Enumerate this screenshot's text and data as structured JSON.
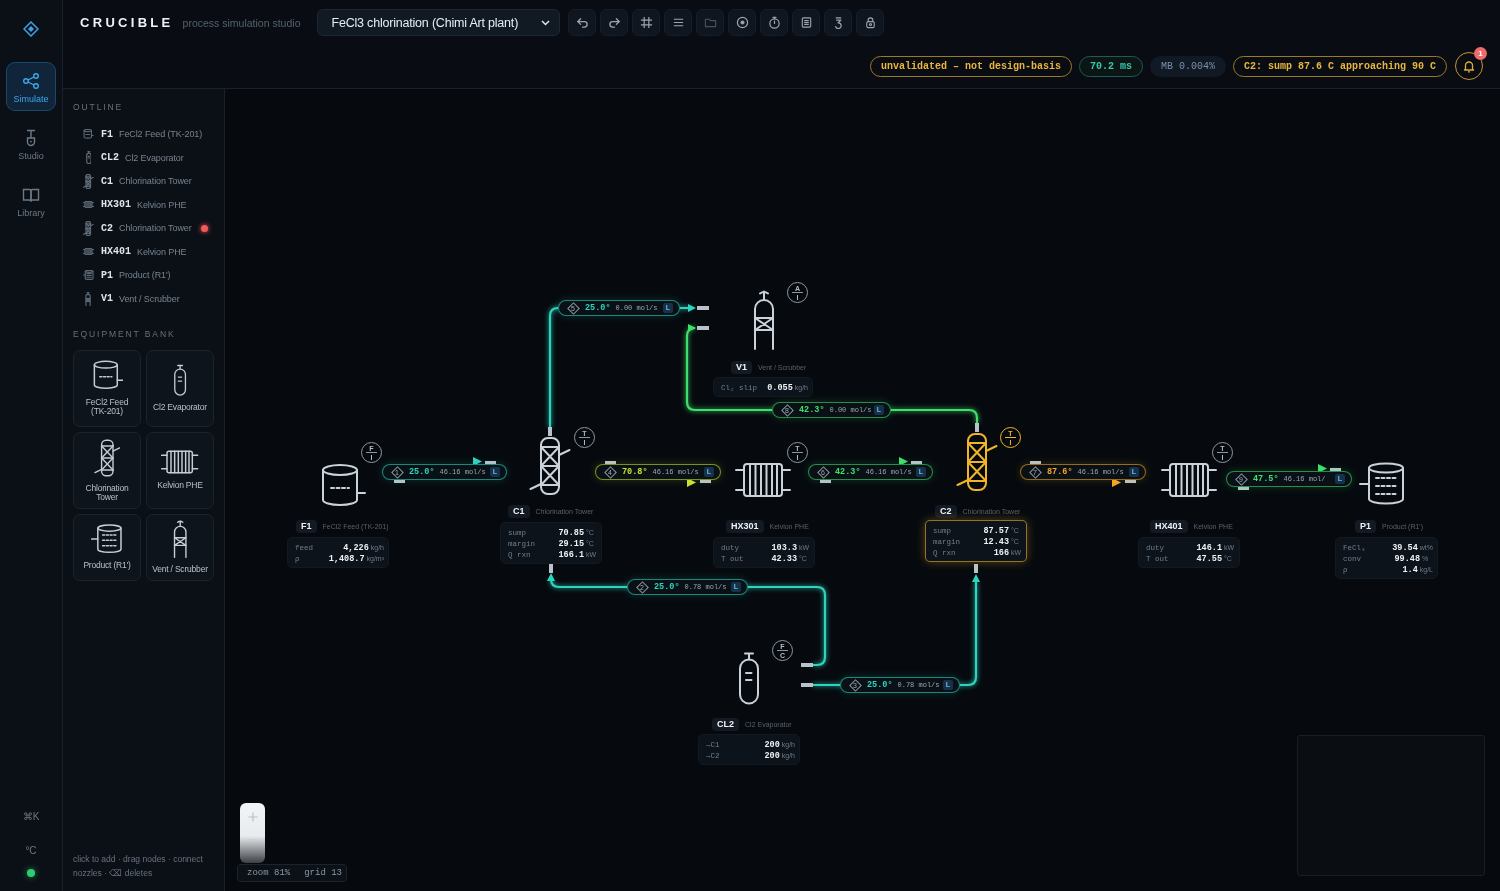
{
  "brand": {
    "name": "CRUCIBLE",
    "tagline": "process simulation studio"
  },
  "nav": [
    {
      "label": "Simulate",
      "kind": "share",
      "selected": true
    },
    {
      "label": "Studio",
      "kind": "shovel",
      "selected": false
    },
    {
      "label": "Library",
      "kind": "book",
      "selected": false
    }
  ],
  "rail_footer": {
    "shortcut": "⌘K",
    "unit": "°C",
    "connected": true
  },
  "project_select": {
    "value": "FeCl3 chlorination (Chimi Art plant)"
  },
  "toolbar": [
    {
      "kind": "undo",
      "disabled": false
    },
    {
      "kind": "redo",
      "disabled": false
    },
    {
      "kind": "frame",
      "disabled": false
    },
    {
      "kind": "list",
      "disabled": false
    },
    {
      "kind": "folder",
      "disabled": true
    },
    {
      "kind": "target",
      "disabled": false
    },
    {
      "kind": "stopwatch",
      "disabled": false
    },
    {
      "kind": "sheet",
      "disabled": false
    },
    {
      "kind": "glyph",
      "disabled": false
    },
    {
      "kind": "padlock",
      "disabled": false
    }
  ],
  "status_badges": [
    {
      "text": "unvalidated – not design-basis",
      "kind": "warning"
    },
    {
      "text": "70.2 ms",
      "kind": "timing"
    },
    {
      "text": "MB 0.004%",
      "kind": "neutral"
    },
    {
      "text": "C2: sump 87.6 C approaching 90 C",
      "kind": "warning"
    }
  ],
  "notifications": {
    "count": "1"
  },
  "outline": {
    "title": "OUTLINE",
    "items": [
      {
        "tag": "F1",
        "name": "FeCl2 Feed (TK-201)",
        "kind": "tank",
        "alarm": false
      },
      {
        "tag": "CL2",
        "name": "Cl2 Evaporator",
        "kind": "evaporator",
        "alarm": false
      },
      {
        "tag": "C1",
        "name": "Chlorination Tower",
        "kind": "column",
        "alarm": false
      },
      {
        "tag": "HX301",
        "name": "Kelvion PHE",
        "kind": "phe",
        "alarm": false
      },
      {
        "tag": "C2",
        "name": "Chlorination Tower",
        "kind": "column",
        "alarm": true
      },
      {
        "tag": "HX401",
        "name": "Kelvion PHE",
        "kind": "phe",
        "alarm": false
      },
      {
        "tag": "P1",
        "name": "Product (R1')",
        "kind": "product",
        "alarm": false
      },
      {
        "tag": "V1",
        "name": "Vent / Scrubber",
        "kind": "vent",
        "alarm": false
      }
    ]
  },
  "equipment_bank": {
    "title": "EQUIPMENT BANK",
    "items": [
      {
        "label": "FeCl2 Feed (TK-201)",
        "kind": "tank"
      },
      {
        "label": "Cl2 Evaporator",
        "kind": "evaporator"
      },
      {
        "label": "Chlorination Tower",
        "kind": "column"
      },
      {
        "label": "Kelvion PHE",
        "kind": "phe"
      },
      {
        "label": "Product (R1')",
        "kind": "product"
      },
      {
        "label": "Vent / Scrubber",
        "kind": "vent"
      }
    ]
  },
  "hint": "click to add · drag nodes · connect nozzles · ⌫ deletes",
  "canvas": {
    "nodes": [
      {
        "tag": "F1",
        "name": "FeCl2 Feed (TK-201)",
        "kind": "tank",
        "alarm": false,
        "instrument": {
          "variable": "F",
          "function": "I"
        },
        "readings": [
          {
            "label": "feed",
            "value": "4,226",
            "unit": "kg/h"
          },
          {
            "label": "ρ",
            "value": "1,408.7",
            "unit": "kg/m³"
          }
        ]
      },
      {
        "tag": "CL2",
        "name": "Cl2 Evaporator",
        "kind": "evaporator",
        "alarm": false,
        "instrument": {
          "variable": "F",
          "function": "C"
        },
        "readings": [
          {
            "label": "→C1",
            "value": "200",
            "unit": "kg/h"
          },
          {
            "label": "→C2",
            "value": "200",
            "unit": "kg/h"
          }
        ]
      },
      {
        "tag": "C1",
        "name": "Chlorination Tower",
        "kind": "column",
        "alarm": false,
        "instrument": {
          "variable": "T",
          "function": "I"
        },
        "readings": [
          {
            "label": "sump",
            "value": "70.85",
            "unit": "°C"
          },
          {
            "label": "margin",
            "value": "29.15",
            "unit": "°C"
          },
          {
            "label": "Q rxn",
            "value": "166.1",
            "unit": "kW"
          }
        ]
      },
      {
        "tag": "HX301",
        "name": "Kelvion PHE",
        "kind": "phe",
        "alarm": false,
        "instrument": {
          "variable": "T",
          "function": "I"
        },
        "readings": [
          {
            "label": "duty",
            "value": "103.3",
            "unit": "kW"
          },
          {
            "label": "T out",
            "value": "42.33",
            "unit": "°C"
          }
        ]
      },
      {
        "tag": "C2",
        "name": "Chlorination Tower",
        "kind": "column",
        "alarm": true,
        "instrument": {
          "variable": "T",
          "function": "I"
        },
        "readings": [
          {
            "label": "sump",
            "value": "87.57",
            "unit": "°C"
          },
          {
            "label": "margin",
            "value": "12.43",
            "unit": "°C"
          },
          {
            "label": "Q rxn",
            "value": "166",
            "unit": "kW"
          }
        ]
      },
      {
        "tag": "HX401",
        "name": "Kelvion PHE",
        "kind": "phe",
        "alarm": false,
        "instrument": {
          "variable": "T",
          "function": "I"
        },
        "readings": [
          {
            "label": "duty",
            "value": "146.1",
            "unit": "kW"
          },
          {
            "label": "T out",
            "value": "47.55",
            "unit": "°C"
          }
        ]
      },
      {
        "tag": "P1",
        "name": "Product (R1')",
        "kind": "product",
        "alarm": false,
        "readings": [
          {
            "label": "FeCl₃",
            "value": "39.54",
            "unit": "wt%"
          },
          {
            "label": "conv",
            "value": "99.48",
            "unit": "%"
          },
          {
            "label": "ρ",
            "value": "1.4",
            "unit": "kg/L"
          }
        ]
      },
      {
        "tag": "V1",
        "name": "Vent / Scrubber",
        "kind": "vent",
        "alarm": false,
        "instrument": {
          "variable": "A",
          "function": "I"
        },
        "readings": [
          {
            "label": "Cl₂ slip",
            "value": "0.055",
            "unit": "kg/h"
          }
        ]
      }
    ],
    "streams": [
      {
        "number": "5",
        "temperature": "25.0°",
        "flow": "0.00 mol/s",
        "phase": "L",
        "color": "#2dd4bf"
      },
      {
        "number": "8",
        "temperature": "42.3°",
        "flow": "0.00 mol/s",
        "phase": "L",
        "color": "#3ee06b"
      },
      {
        "number": "1",
        "temperature": "25.0°",
        "flow": "46.16 mol/s",
        "phase": "L",
        "color": "#2dd4bf"
      },
      {
        "number": "4",
        "temperature": "70.8°",
        "flow": "46.16 mol/s",
        "phase": "L",
        "color": "#c6e22f"
      },
      {
        "number": "6",
        "temperature": "42.3°",
        "flow": "46.16 mol/s",
        "phase": "L",
        "color": "#3ee06b"
      },
      {
        "number": "7",
        "temperature": "87.6°",
        "flow": "46.16 mol/s",
        "phase": "L",
        "color": "#f5a623"
      },
      {
        "number": "9",
        "temperature": "47.5°",
        "flow": "46.16 mol/",
        "phase": "L",
        "color": "#3ee06b"
      },
      {
        "number": "2",
        "temperature": "25.0°",
        "flow": "0.78 mol/s",
        "phase": "L",
        "color": "#2dd4bf"
      },
      {
        "number": "3",
        "temperature": "25.0°",
        "flow": "0.78 mol/s",
        "phase": "L",
        "color": "#2dd4bf"
      }
    ],
    "status": {
      "zoom": "zoom 81%",
      "grid": "grid 13"
    }
  }
}
